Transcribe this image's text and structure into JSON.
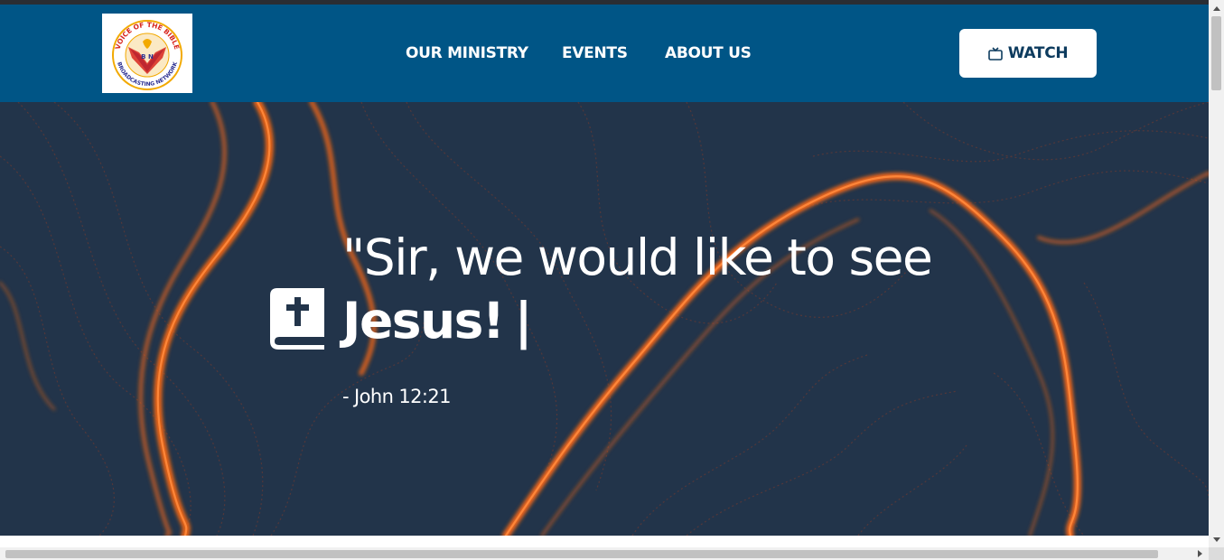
{
  "header": {
    "logo": {
      "icon": "voice-of-the-bible-logo",
      "text_top": "VOICE OF THE BIBLE",
      "text_bottom": "BROADCASTING NETWORK",
      "initials": "B N",
      "colors": {
        "ring": "#f2a900",
        "red": "#d7261e",
        "blue": "#2e3192"
      }
    },
    "nav": [
      {
        "label": "OUR MINISTRY"
      },
      {
        "label": "EVENTS"
      },
      {
        "label": "ABOUT US"
      }
    ],
    "watch_button": {
      "label": "WATCH",
      "icon": "tv-icon"
    },
    "background_color": "#005586"
  },
  "hero": {
    "quote_line1": "\"Sir, we would like to see",
    "quote_line2": "Jesus!",
    "cursor": "|",
    "reference": "- John 12:21",
    "icon": "bible-icon",
    "background_color": "#22344a",
    "accent_color": "#ff6a13"
  }
}
